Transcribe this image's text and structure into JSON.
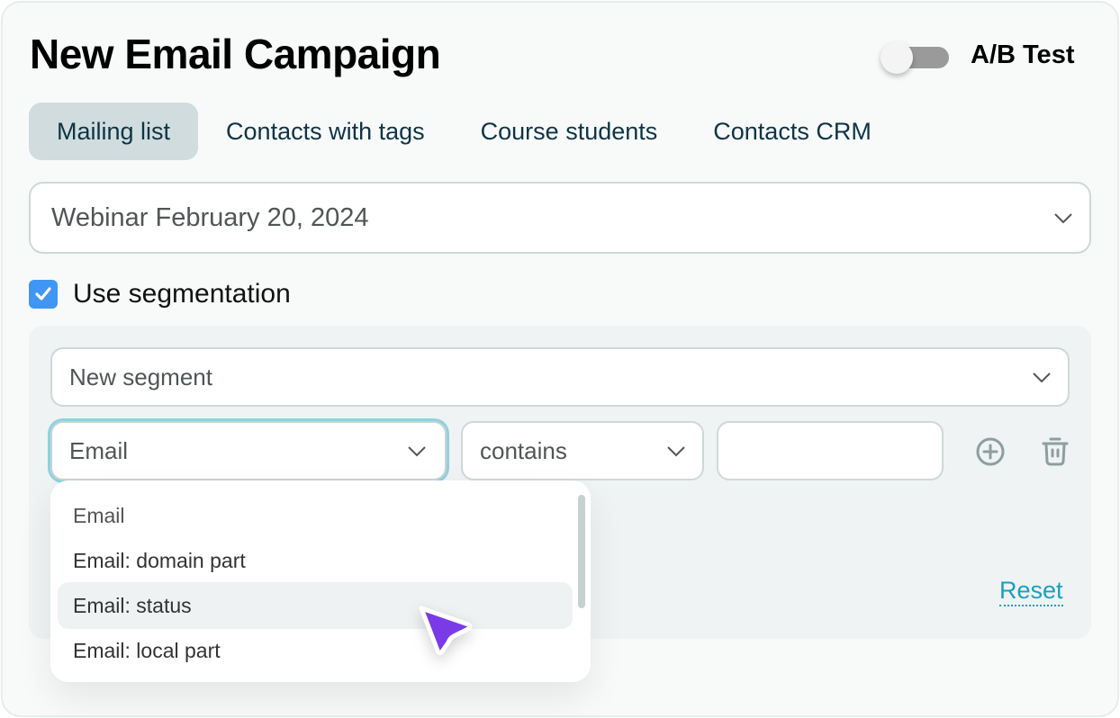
{
  "header": {
    "title": "New Email Campaign",
    "ab_test": {
      "label": "A/B Test",
      "enabled": false
    }
  },
  "tabs": [
    {
      "label": "Mailing list",
      "active": true
    },
    {
      "label": "Contacts with tags",
      "active": false
    },
    {
      "label": "Course students",
      "active": false
    },
    {
      "label": "Contacts CRM",
      "active": false
    }
  ],
  "mailing_list_select": {
    "value": "Webinar February 20, 2024",
    "icon": "chevron-down-icon"
  },
  "segmentation": {
    "checkbox_label": "Use segmentation",
    "checked": true,
    "segment_select": {
      "value": "New segment",
      "icon": "chevron-down-icon"
    },
    "condition": {
      "field": "Email",
      "operator": "contains",
      "value": "",
      "add_icon": "plus-circle-icon",
      "delete_icon": "trash-icon"
    },
    "reset_label": "Reset"
  },
  "field_dropdown": {
    "options": [
      {
        "label": "Email",
        "state": "selected"
      },
      {
        "label": "Email: domain part",
        "state": "normal"
      },
      {
        "label": "Email: status",
        "state": "hover"
      },
      {
        "label": "Email: local part",
        "state": "normal"
      }
    ]
  },
  "colors": {
    "accent_link": "#1aa0c0",
    "checkbox": "#4096f4",
    "cursor": "#7a3ae8",
    "active_tab_bg": "#d0dcdd",
    "focus_ring": "#8fd2e0"
  }
}
